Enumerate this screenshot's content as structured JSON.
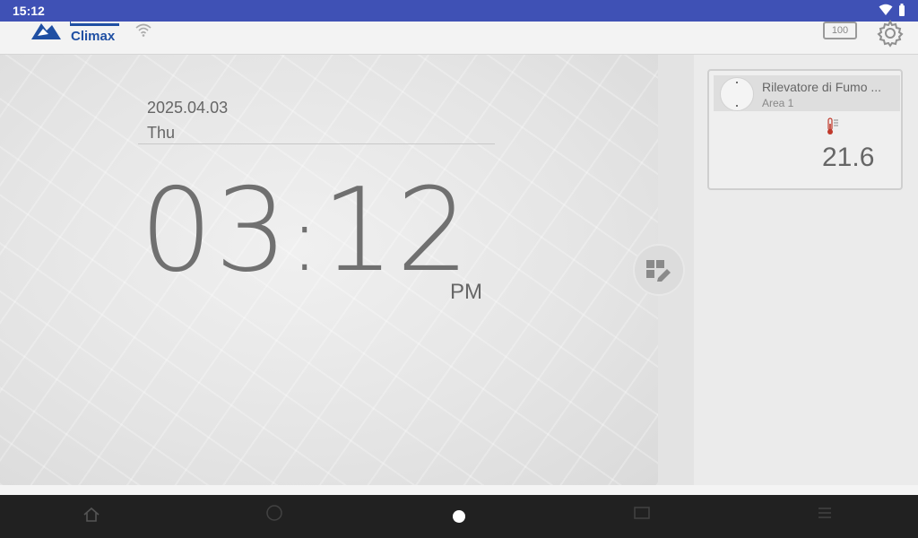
{
  "status_bar": {
    "time": "15:12",
    "icons": [
      "wifi-icon",
      "battery-icon"
    ]
  },
  "header": {
    "logo_text": "Climax",
    "battery_level": "100",
    "icons": [
      "wifi-signal-icon",
      "settings-gear-icon"
    ]
  },
  "clock": {
    "date": "2025.04.03",
    "day": "Thu",
    "hours": "03",
    "minutes": "12",
    "ampm": "PM"
  },
  "device_card": {
    "title": "Rilevatore di Fumo ...",
    "area": "Area 1",
    "temperature": "21.6",
    "icons": [
      "smoke-detector-icon",
      "thermometer-icon"
    ]
  },
  "nav": {
    "icons": [
      "home-icon",
      "circle-icon",
      "home-dot",
      "card-icon",
      "list-icon"
    ]
  },
  "colors": {
    "status_bar": "#3f51b5",
    "logo": "#1f4fa3",
    "nav_bar": "#212121"
  }
}
